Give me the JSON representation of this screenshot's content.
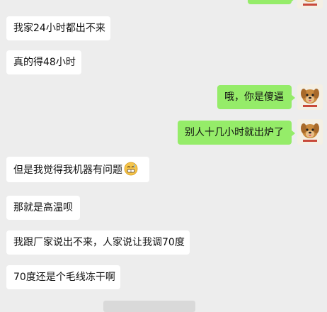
{
  "conversation": {
    "messages": [
      {
        "side": "right",
        "text": ""
      },
      {
        "side": "left",
        "text": "我家24小时都出不来"
      },
      {
        "side": "left",
        "text": "真的得48小时"
      },
      {
        "side": "right",
        "text": "哦，你是傻逼"
      },
      {
        "side": "right",
        "text": "别人十几小时就出炉了"
      },
      {
        "side": "left",
        "text": "但是我觉得我机器有问题",
        "emoji": "grimace-emoji"
      },
      {
        "side": "left",
        "text": "那就是高温呗"
      },
      {
        "side": "left",
        "text": "我跟厂家说出不来，人家说让我调70度"
      },
      {
        "side": "left",
        "text": "70度还是个毛线冻干啊"
      }
    ],
    "timestamp": ""
  },
  "avatar": {
    "icon": "dog-avatar-icon"
  },
  "colors": {
    "background": "#ededed",
    "incoming_bubble": "#ffffff",
    "outgoing_bubble": "#95ec69"
  }
}
